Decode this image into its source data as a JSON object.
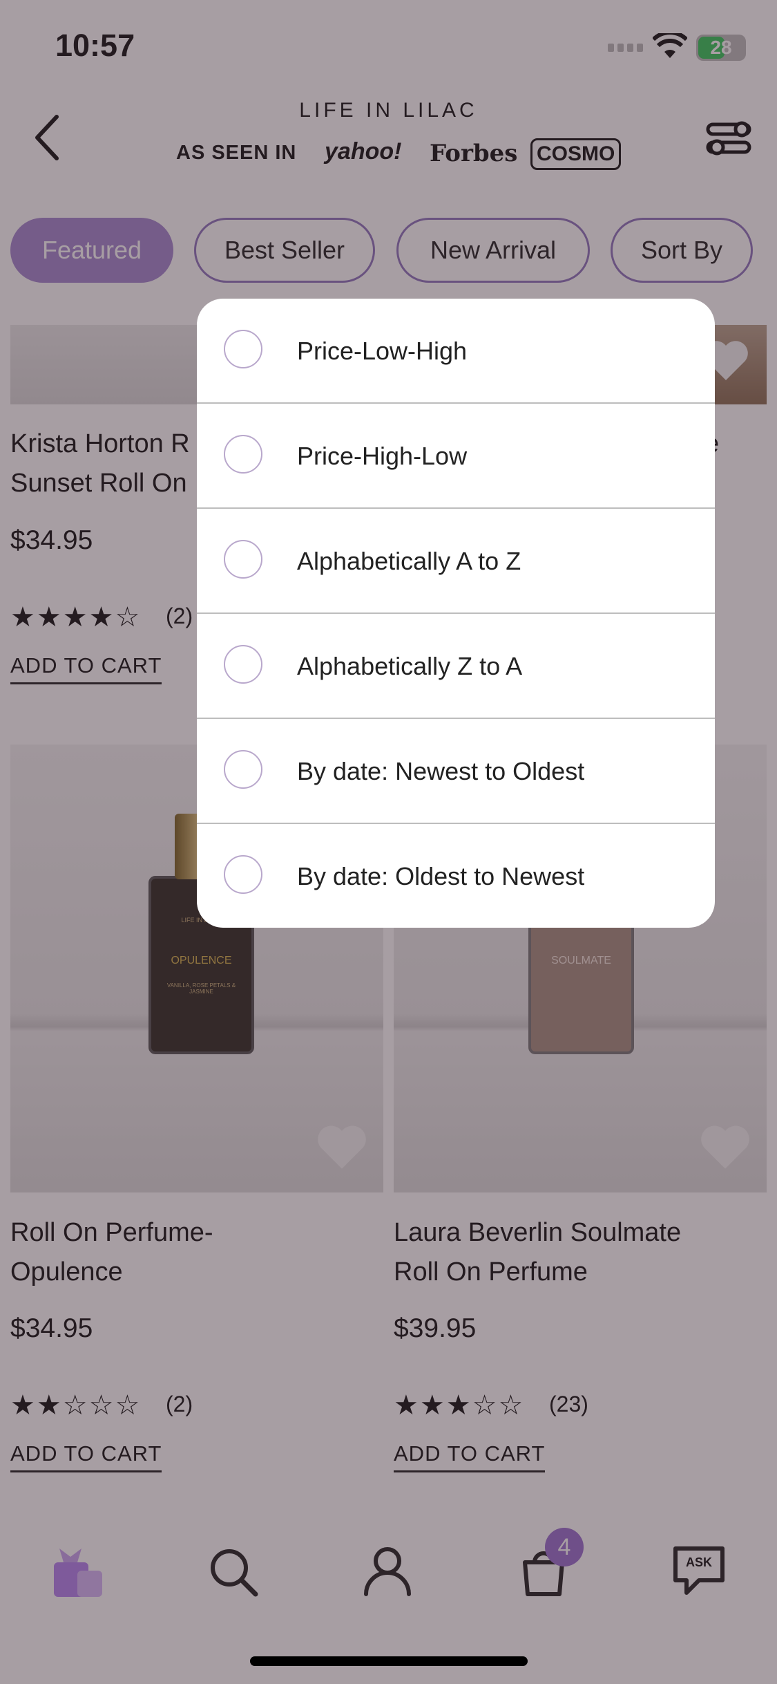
{
  "status_bar": {
    "time": "10:57",
    "battery": "28"
  },
  "header": {
    "brand": "LIFE IN LILAC",
    "as_seen_in": "AS SEEN IN",
    "press": [
      "yahoo!",
      "Forbes",
      "COSMO"
    ]
  },
  "filters": {
    "chips": [
      "Featured",
      "Best Seller",
      "New Arrival",
      "Sort By"
    ],
    "active": "Featured"
  },
  "products": [
    {
      "title": "Krista Horton Rosy Sunset Roll On Perfume",
      "price": "$34.95",
      "rating": 4,
      "count": "(2)",
      "cta": "ADD TO CART"
    },
    {
      "title": "",
      "price": "",
      "rating": 0,
      "count": "",
      "cta": ""
    },
    {
      "title": "Roll On Perfume- Opulence",
      "title_line1": "Roll On Perfume-",
      "title_line2": "Opulence",
      "price": "$34.95",
      "rating": 2,
      "count": "(2)",
      "cta": "ADD TO CART",
      "label": "OPULENCE",
      "label_brand": "LIFE IN LILAC",
      "label_notes": "VANILLA, ROSE PETALS & JASMINE"
    },
    {
      "title": "Laura Beverlin Soulmate Roll On Perfume",
      "title_line1": "Laura Beverlin Soulmate",
      "title_line2": "Roll On Perfume",
      "price": "$39.95",
      "rating": 3,
      "count": "(23)",
      "cta": "ADD TO CART",
      "label": "SOULMATE"
    }
  ],
  "product1_lines": {
    "line1": "Krista Horton R",
    "line2": "Sunset Roll On"
  },
  "product2_partial": "e",
  "tab_bar": {
    "items": [
      "home-icon",
      "search-icon",
      "account-icon",
      "cart-icon",
      "ask-icon"
    ],
    "cart_badge": "4",
    "ask_label": "ASK"
  },
  "sort_menu": {
    "options": [
      "Price-Low-High",
      "Price-High-Low",
      "Alphabetically A to Z",
      "Alphabetically Z to A",
      "By date: Newest to Oldest",
      "By date: Oldest to Newest"
    ]
  },
  "colors": {
    "accent": "#a487cf",
    "badge": "#9a6fcf",
    "overlay": "rgba(60,40,50,0.45)"
  }
}
